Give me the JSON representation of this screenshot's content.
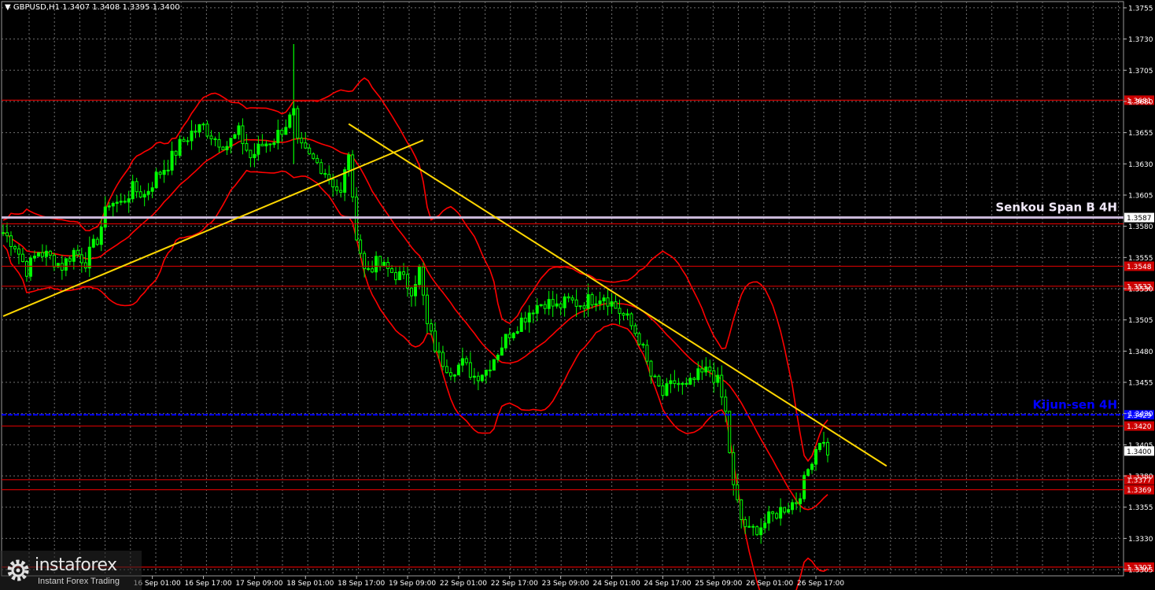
{
  "header": {
    "text": "▼ GBPUSD,H1  1.3407 1.3408 1.3395 1.3400"
  },
  "branding": {
    "name": "instaforex",
    "tagline": "Instant Forex Trading"
  },
  "colors": {
    "background": "#000000",
    "grid": "#6f6f6f",
    "bull_candle": "#00ff00",
    "bear_candle": "#00cc00",
    "bands": "#ff0000",
    "support_resistance": "#cc0000",
    "trendline": "#ffd700",
    "senkou": "#c9b8d8",
    "kijun": "#0000ff",
    "axis_text": "#ffffff"
  },
  "chart_data": {
    "type": "candlestick",
    "symbol": "GBPUSD",
    "timeframe": "H1",
    "ylim": [
      1.33,
      1.376
    ],
    "y_ticks": [
      "1.3755",
      "1.3730",
      "1.3705",
      "1.3680",
      "1.3655",
      "1.3630",
      "1.3605",
      "1.3580",
      "1.3555",
      "1.3530",
      "1.3505",
      "1.3480",
      "1.3455",
      "1.3430",
      "1.3405",
      "1.3380",
      "1.3355",
      "1.3330",
      "1.3305"
    ],
    "x_ticks": [
      "16 Sep 01:00",
      "16 Sep 17:00",
      "17 Sep 09:00",
      "18 Sep 01:00",
      "18 Sep 17:00",
      "19 Sep 09:00",
      "22 Sep 01:00",
      "22 Sep 17:00",
      "23 Sep 09:00",
      "24 Sep 01:00",
      "24 Sep 17:00",
      "25 Sep 09:00",
      "26 Sep 01:00",
      "26 Sep 17:00"
    ],
    "x_index_range": [
      0,
      210
    ],
    "x_tick_indices": [
      38,
      51,
      64,
      77,
      90,
      103,
      116,
      129,
      142,
      155,
      168,
      181,
      194,
      207
    ],
    "last_price": {
      "value": 1.34,
      "label": "1.3400"
    },
    "horizontal_levels": [
      {
        "value": 1.3681,
        "label": "1.3681",
        "kind": "support_resistance"
      },
      {
        "value": 1.3587,
        "label": "1.3587",
        "kind": "senkou"
      },
      {
        "value": 1.3582,
        "kind": "support_resistance"
      },
      {
        "value": 1.3548,
        "label": "1.3548",
        "kind": "support_resistance"
      },
      {
        "value": 1.3532,
        "label": "1.3532",
        "kind": "support_resistance"
      },
      {
        "value": 1.3429,
        "label": "1.3429",
        "kind": "kijun"
      },
      {
        "value": 1.342,
        "label": "1.3420",
        "kind": "support_resistance"
      },
      {
        "value": 1.3377,
        "label": "1.3377",
        "kind": "support_resistance"
      },
      {
        "value": 1.3369,
        "label": "1.3369",
        "kind": "support_resistance"
      },
      {
        "value": 1.3307,
        "label": "1.3307",
        "kind": "support_resistance"
      }
    ],
    "annotations": [
      {
        "text": "Senkou Span B 4H",
        "near_level": 1.3587
      },
      {
        "text": "Kijun-sen 4H",
        "near_level": 1.3429
      }
    ],
    "trendlines": [
      {
        "from": [
          0,
          1.3508
        ],
        "to": [
          107,
          1.3649
        ]
      },
      {
        "from": [
          88,
          1.3662
        ],
        "to": [
          225,
          1.3388
        ]
      }
    ],
    "close_series_keypoints": [
      [
        0,
        1.3575
      ],
      [
        3,
        1.3565
      ],
      [
        6,
        1.3545
      ],
      [
        9,
        1.356
      ],
      [
        12,
        1.3555
      ],
      [
        15,
        1.3548
      ],
      [
        18,
        1.356
      ],
      [
        21,
        1.3552
      ],
      [
        24,
        1.357
      ],
      [
        27,
        1.36
      ],
      [
        30,
        1.3598
      ],
      [
        33,
        1.361
      ],
      [
        36,
        1.3605
      ],
      [
        39,
        1.362
      ],
      [
        42,
        1.363
      ],
      [
        45,
        1.3645
      ],
      [
        48,
        1.3655
      ],
      [
        51,
        1.366
      ],
      [
        54,
        1.365
      ],
      [
        57,
        1.3645
      ],
      [
        60,
        1.3655
      ],
      [
        63,
        1.3635
      ],
      [
        66,
        1.3645
      ],
      [
        69,
        1.365
      ],
      [
        72,
        1.3662
      ],
      [
        74,
        1.367
      ],
      [
        75,
        1.3645
      ],
      [
        78,
        1.3635
      ],
      [
        81,
        1.3628
      ],
      [
        84,
        1.3615
      ],
      [
        86,
        1.3605
      ],
      [
        88,
        1.364
      ],
      [
        89,
        1.3598
      ],
      [
        90,
        1.3575
      ],
      [
        92,
        1.3545
      ],
      [
        95,
        1.355
      ],
      [
        98,
        1.3545
      ],
      [
        101,
        1.354
      ],
      [
        104,
        1.353
      ],
      [
        106,
        1.3545
      ],
      [
        108,
        1.35
      ],
      [
        111,
        1.3475
      ],
      [
        114,
        1.3465
      ],
      [
        117,
        1.347
      ],
      [
        120,
        1.346
      ],
      [
        123,
        1.3465
      ],
      [
        126,
        1.348
      ],
      [
        129,
        1.3495
      ],
      [
        132,
        1.3505
      ],
      [
        135,
        1.3515
      ],
      [
        138,
        1.352
      ],
      [
        141,
        1.3515
      ],
      [
        144,
        1.352
      ],
      [
        147,
        1.3518
      ],
      [
        150,
        1.3522
      ],
      [
        153,
        1.3525
      ],
      [
        156,
        1.3515
      ],
      [
        159,
        1.3505
      ],
      [
        162,
        1.349
      ],
      [
        165,
        1.346
      ],
      [
        168,
        1.3445
      ],
      [
        171,
        1.3455
      ],
      [
        174,
        1.345
      ],
      [
        177,
        1.346
      ],
      [
        180,
        1.3465
      ],
      [
        182,
        1.3455
      ],
      [
        184,
        1.343
      ],
      [
        186,
        1.337
      ],
      [
        188,
        1.3345
      ],
      [
        190,
        1.3335
      ],
      [
        193,
        1.334
      ],
      [
        196,
        1.3348
      ],
      [
        199,
        1.3355
      ],
      [
        202,
        1.336
      ],
      [
        204,
        1.3375
      ],
      [
        206,
        1.3395
      ],
      [
        208,
        1.341
      ],
      [
        209,
        1.3405
      ],
      [
        210,
        1.34
      ]
    ],
    "spikes": [
      {
        "x": 74,
        "high": 1.3726,
        "low": 1.363
      }
    ]
  }
}
